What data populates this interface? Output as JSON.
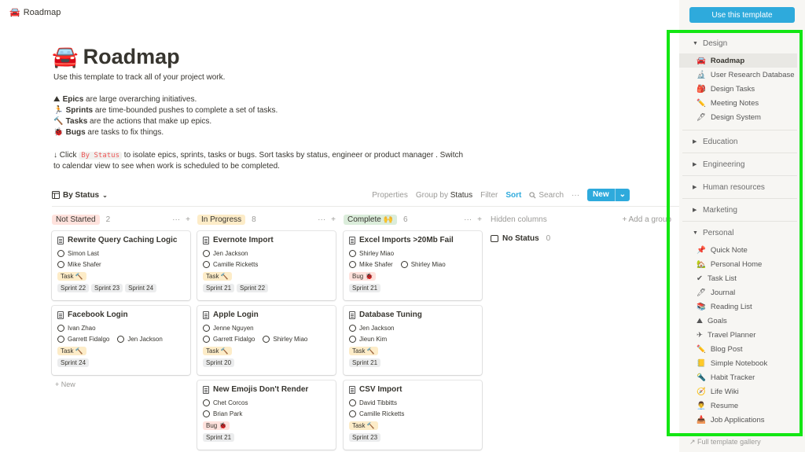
{
  "page": {
    "breadcrumb_icon": "🚘",
    "breadcrumb": "Roadmap",
    "title_icon": "🚘",
    "title": "Roadmap",
    "intro": "Use this template to track all of your project work.",
    "defs": [
      {
        "icon": "⛰",
        "term": "Epics",
        "text": " are large overarching initiatives."
      },
      {
        "icon": "🏃",
        "term": "Sprints",
        "text": " are time-bounded pushes to complete a set of tasks."
      },
      {
        "icon": "🔨",
        "term": "Tasks",
        "text": " are the actions that make up epics."
      },
      {
        "icon": "🐞",
        "term": "Bugs",
        "text": " are tasks to fix things."
      }
    ],
    "click_pre": "↓ Click ",
    "click_code": "By Status",
    "click_post": " to isolate epics, sprints, tasks or bugs. Sort tasks by status, engineer or product manager . Switch",
    "click_line2": "to calendar view to see when work is scheduled to be completed."
  },
  "toolbar": {
    "view": "By Status",
    "properties": "Properties",
    "group_by": "Group by",
    "group_value": "Status",
    "filter": "Filter",
    "sort": "Sort",
    "search": "Search",
    "more": "···",
    "new": "New",
    "caret": "⌄"
  },
  "columns": [
    {
      "status": "Not Started",
      "count": "2",
      "cards": [
        {
          "title": "Rewrite Query Caching Logic",
          "people": [
            [
              "Simon Last"
            ],
            [
              "Mike Shafer"
            ]
          ],
          "type": "Task 🔨",
          "sprints": [
            "Sprint 22",
            "Sprint 23",
            "Sprint 24"
          ]
        },
        {
          "title": "Facebook Login",
          "people": [
            [
              "Ivan Zhao"
            ],
            [
              "Garrett Fidalgo",
              "Jen Jackson"
            ]
          ],
          "type": "Task 🔨",
          "sprints": [
            "Sprint 24"
          ]
        }
      ],
      "new_label": "+ New"
    },
    {
      "status": "In Progress",
      "count": "8",
      "cards": [
        {
          "title": "Evernote Import",
          "people": [
            [
              "Jen Jackson"
            ],
            [
              "Camille Ricketts"
            ]
          ],
          "type": "Task 🔨",
          "sprints": [
            "Sprint 21",
            "Sprint 22"
          ]
        },
        {
          "title": "Apple Login",
          "people": [
            [
              "Jenne Nguyen"
            ],
            [
              "Garrett Fidalgo",
              "Shirley Miao"
            ]
          ],
          "type": "Task 🔨",
          "sprints": [
            "Sprint 20"
          ]
        },
        {
          "title": "New Emojis Don't Render",
          "people": [
            [
              "Chet Corcos"
            ],
            [
              "Brian Park"
            ]
          ],
          "type": "Bug 🐞",
          "sprints": [
            "Sprint 21"
          ]
        }
      ]
    },
    {
      "status": "Complete 🙌",
      "count": "6",
      "cards": [
        {
          "title": "Excel Imports >20Mb Fail",
          "people": [
            [
              "Shirley Miao"
            ],
            [
              "Mike Shafer",
              "Shirley Miao"
            ]
          ],
          "type": "Bug 🐞",
          "sprints": [
            "Sprint 21"
          ]
        },
        {
          "title": "Database Tuning",
          "people": [
            [
              "Jen Jackson"
            ],
            [
              "Jieun Kim"
            ]
          ],
          "type": "Task 🔨",
          "sprints": [
            "Sprint 21"
          ]
        },
        {
          "title": "CSV Import",
          "people": [
            [
              "David Tibbitts"
            ],
            [
              "Camille Ricketts"
            ]
          ],
          "type": "Task 🔨",
          "sprints": [
            "Sprint 23"
          ]
        }
      ]
    }
  ],
  "hidden": {
    "label": "Hidden columns",
    "add_group": "+ Add a group",
    "no_status": "No Status",
    "no_status_count": "0"
  },
  "sidebar": {
    "use_template": "Use this template",
    "categories": [
      {
        "label": "Design",
        "open": true,
        "items": [
          {
            "icon": "🚘",
            "label": "Roadmap",
            "active": true
          },
          {
            "icon": "🔬",
            "label": "User Research Database"
          },
          {
            "icon": "🎒",
            "label": "Design Tasks"
          },
          {
            "icon": "✏️",
            "label": "Meeting Notes"
          },
          {
            "icon": "🖋",
            "label": "Design System"
          }
        ]
      },
      {
        "label": "Education",
        "open": false,
        "items": []
      },
      {
        "label": "Engineering",
        "open": false,
        "items": []
      },
      {
        "label": "Human resources",
        "open": false,
        "items": []
      },
      {
        "label": "Marketing",
        "open": false,
        "items": []
      },
      {
        "label": "Personal",
        "open": true,
        "items": [
          {
            "icon": "📌",
            "label": "Quick Note"
          },
          {
            "icon": "🏡",
            "label": "Personal Home"
          },
          {
            "icon": "✔",
            "label": "Task List"
          },
          {
            "icon": "🖊",
            "label": "Journal"
          },
          {
            "icon": "📚",
            "label": "Reading List"
          },
          {
            "icon": "⛰",
            "label": "Goals"
          },
          {
            "icon": "✈",
            "label": "Travel Planner"
          },
          {
            "icon": "✏️",
            "label": "Blog Post"
          },
          {
            "icon": "📒",
            "label": "Simple Notebook"
          },
          {
            "icon": "🔦",
            "label": "Habit Tracker"
          },
          {
            "icon": "🧭",
            "label": "Life Wiki"
          },
          {
            "icon": "👨‍💼",
            "label": "Resume"
          },
          {
            "icon": "📥",
            "label": "Job Applications"
          }
        ]
      }
    ],
    "gallery": "↗  Full template gallery",
    "highlight_color": "#13e613"
  }
}
